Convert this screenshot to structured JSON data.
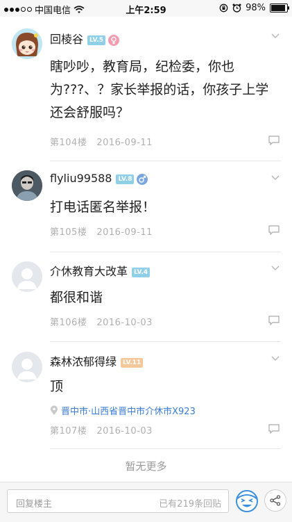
{
  "status_bar": {
    "carrier": "中国电信",
    "time": "上午2:59",
    "battery_text": "98%",
    "battery_level": 0.98,
    "signal_dots_filled": 3,
    "signal_dots_total": 5
  },
  "posts": [
    {
      "username": "回棱谷",
      "level": "LV.5",
      "level_color": "#8fd0e8",
      "gender": "female",
      "gender_color": "#f59bb0",
      "avatar": "cartoon-girl",
      "content": "瞎吵吵，教育局，纪检委，你也为???、？家长举报的话，你孩子上学还会舒服吗？",
      "floor": "第104楼",
      "date": "2016-09-11"
    },
    {
      "username": "flyliu99588",
      "level": "LV.8",
      "level_color": "#8fd0e8",
      "gender": "male",
      "gender_color": "#7aa7e0",
      "avatar": "photo-person",
      "content": "打电话匿名举报！",
      "floor": "第105楼",
      "date": "2016-09-11"
    },
    {
      "username": "介休教育大改革",
      "level": "LV.4",
      "level_color": "#8fd0e8",
      "avatar": "default",
      "content": "都很和谐",
      "floor": "第106楼",
      "date": "2016-10-03"
    },
    {
      "username": "森林浓郁得绿",
      "level": "LV.11",
      "level_color": "#f5c89b",
      "avatar": "default",
      "content": "顶",
      "location": "晋中市·山西省晋中市介休市X923",
      "floor": "第107楼",
      "date": "2016-10-03"
    }
  ],
  "no_more": "暂无更多",
  "bottom_bar": {
    "reply_placeholder": "回复楼主",
    "reply_count": "已有219条回贴"
  }
}
